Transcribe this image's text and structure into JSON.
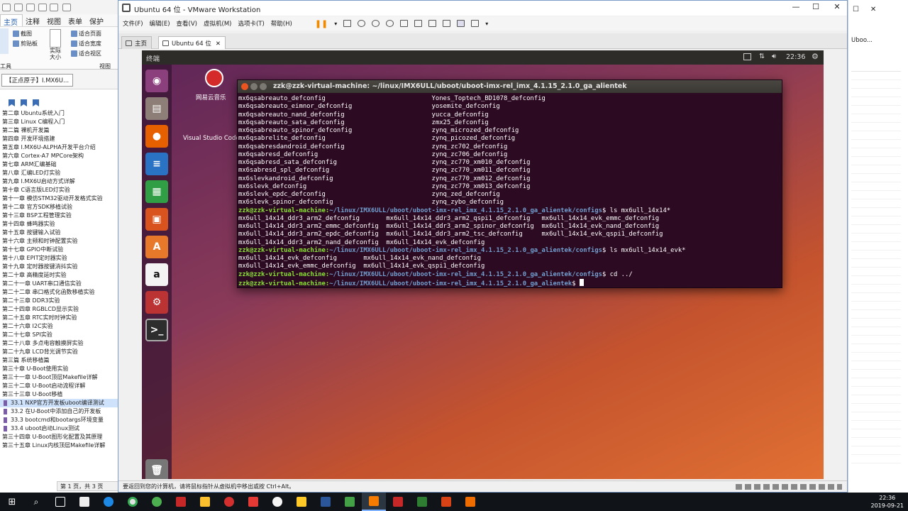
{
  "pdf_reader": {
    "tabs": [
      "主页",
      "注释",
      "视图",
      "表单",
      "保护"
    ],
    "ribbon": {
      "screenshot": "截图",
      "clipboard": "剪贴板",
      "actual_size": "实际大小",
      "fit_page": "适合页面",
      "fit_width": "适合宽度",
      "fit_view": "适合视区",
      "tools_group": "工具",
      "view_group": "视图"
    },
    "doc_tab": "【正点原子】I.MX6U...",
    "toc": [
      {
        "label": "第二章 Ubuntu系统入门"
      },
      {
        "label": "第三章 Linux C编程入门"
      },
      {
        "label": "第二篇 裸机开发篇"
      },
      {
        "label": "第四章 开发环境搭建"
      },
      {
        "label": "第五章 I.MX6U-ALPHA开发平台介绍"
      },
      {
        "label": "第六章 Cortex-A7 MPCore架构"
      },
      {
        "label": "第七章 ARM汇编基础"
      },
      {
        "label": "第八章 汇编LED灯实验"
      },
      {
        "label": "第九章 I.MX6U启动方式详解"
      },
      {
        "label": "第十章 C语言版LED灯实验"
      },
      {
        "label": "第十一章 模仿STM32驱动开发格式实验"
      },
      {
        "label": "第十二章 官方SDK移植试验"
      },
      {
        "label": "第十三章 BSP工程管理实验"
      },
      {
        "label": "第十四章 蜂鸣器实验"
      },
      {
        "label": "第十五章 按键输入试验"
      },
      {
        "label": "第十六章 主频和时钟配置实验"
      },
      {
        "label": "第十七章 GPIO中断试验"
      },
      {
        "label": "第十八章 EPIT定时器实验"
      },
      {
        "label": "第十九章 定时器按键消抖实验"
      },
      {
        "label": "第二十章 高精度延时实验"
      },
      {
        "label": "第二十一章 UART串口通信实验"
      },
      {
        "label": "第二十二章 串口格式化函数移植实验"
      },
      {
        "label": "第二十三章 DDR3实验"
      },
      {
        "label": "第二十四章 RGBLCD显示实验"
      },
      {
        "label": "第二十五章 RTC实时时钟实验"
      },
      {
        "label": "第二十六章 I2C实验"
      },
      {
        "label": "第二十七章 SPI实验"
      },
      {
        "label": "第二十八章 多点电容触摸屏实验"
      },
      {
        "label": "第二十九章 LCD背光调节实验"
      },
      {
        "label": "第三篇 系统移植篇"
      },
      {
        "label": "第三十章 U-Boot使用实验"
      },
      {
        "label": "第三十一章 U-Boot顶层Makefile详解"
      },
      {
        "label": "第三十二章 U-Boot启动流程详解"
      },
      {
        "label": "第三十三章 U-Boot移植"
      },
      {
        "label": "33.1 NXP官方开发板uboot编译测试",
        "sub": true,
        "selected": true
      },
      {
        "label": "33.2 在U-Boot中添加自己的开发板",
        "sub": true
      },
      {
        "label": "33.3 bootcmd和bootargs环境变量",
        "sub": true
      },
      {
        "label": "33.4 uboot启动Linux测试",
        "sub": true
      },
      {
        "label": "第三十四章 U-Boot图形化配置及其原理"
      },
      {
        "label": "第三十五章 Linux内核顶层Makefile详解"
      }
    ],
    "status": "第 1 页，共 3 页"
  },
  "vmware": {
    "title": "Ubuntu 64 位 - VMware Workstation",
    "menu": [
      "文件(F)",
      "编辑(E)",
      "查看(V)",
      "虚拟机(M)",
      "选项卡(T)",
      "帮助(H)"
    ],
    "tabs": {
      "home": "主页",
      "vm": "Ubuntu 64 位"
    },
    "status_msg": "要返回到您的计算机，请将鼠标指针从虚拟机中移出或按 Ctrl+Alt。",
    "guest": {
      "topbar_title": "终端",
      "clock": "22:36",
      "desktop_icon_label": "网易云音乐",
      "desktop_icon2_label": "Visual Studio Code",
      "launcher": [
        "ubuntu-dash",
        "files",
        "firefox",
        "libreoffice-writer",
        "libreoffice-calc",
        "libreoffice-impress",
        "ubuntu-software",
        "amazon",
        "system-settings",
        "terminal",
        "trash"
      ],
      "terminal": {
        "title": "zzk@zzk-virtual-machine: ~/linux/IMX6ULL/uboot/uboot-imx-rel_imx_4.1.15_2.1.0_ga_alientek",
        "lines": [
          {
            "text": "mx6qsabreauto_defconfig                            Yones_Toptech_BD1078_defconfig"
          },
          {
            "text": "mx6qsabreauto_eimnor_defconfig                     yosemite_defconfig"
          },
          {
            "text": "mx6qsabreauto_nand_defconfig                       yucca_defconfig"
          },
          {
            "text": "mx6qsabreauto_sata_defconfig                       zmx25_defconfig"
          },
          {
            "text": "mx6qsabreauto_spinor_defconfig                     zynq_microzed_defconfig"
          },
          {
            "text": "mx6qsabrelite_defconfig                            zynq_picozed_defconfig"
          },
          {
            "text": "mx6qsabresdandroid_defconfig                       zynq_zc702_defconfig"
          },
          {
            "text": "mx6qsabresd_defconfig                              zynq_zc706_defconfig"
          },
          {
            "text": "mx6qsabresd_sata_defconfig                         zynq_zc770_xm010_defconfig"
          },
          {
            "text": "mx6sabresd_spl_defconfig                           zynq_zc770_xm011_defconfig"
          },
          {
            "text": "mx6slevkandroid_defconfig                          zynq_zc770_xm012_defconfig"
          },
          {
            "text": "mx6slevk_defconfig                                 zynq_zc770_xm013_defconfig"
          },
          {
            "text": "mx6slevk_epdc_defconfig                            zynq_zed_defconfig"
          },
          {
            "text": "mx6slevk_spinor_defconfig                          zynq_zybo_defconfig"
          },
          {
            "user": "zzk@zzk-virtual-machine",
            "path": "~/linux/IMX6ULL/uboot/uboot-imx-rel_imx_4.1.15_2.1.0_ga_alientek/configs",
            "cmd": "$ ls mx6ull_14x14*"
          },
          {
            "text": "mx6ull_14x14_ddr3_arm2_defconfig       mx6ull_14x14_ddr3_arm2_qspi1_defconfig   mx6ull_14x14_evk_emmc_defconfig"
          },
          {
            "text": "mx6ull_14x14_ddr3_arm2_emmc_defconfig  mx6ull_14x14_ddr3_arm2_spinor_defconfig  mx6ull_14x14_evk_nand_defconfig"
          },
          {
            "text": "mx6ull_14x14_ddr3_arm2_epdc_defconfig  mx6ull_14x14_ddr3_arm2_tsc_defconfig     mx6ull_14x14_evk_qspi1_defconfig"
          },
          {
            "text": "mx6ull_14x14_ddr3_arm2_nand_defconfig  mx6ull_14x14_evk_defconfig"
          },
          {
            "user": "zzk@zzk-virtual-machine",
            "path": "~/linux/IMX6ULL/uboot/uboot-imx-rel_imx_4.1.15_2.1.0_ga_alientek/configs",
            "cmd": "$ ls mx6ull_14x14_evk*"
          },
          {
            "text": "mx6ull_14x14_evk_defconfig       mx6ull_14x14_evk_nand_defconfig"
          },
          {
            "text": "mx6ull_14x14_evk_emmc_defconfig  mx6ull_14x14_evk_qspi1_defconfig"
          },
          {
            "user": "zzk@zzk-virtual-machine",
            "path": "~/linux/IMX6ULL/uboot/uboot-imx-rel_imx_4.1.15_2.1.0_ga_alientek/configs",
            "cmd": "$ cd ../"
          },
          {
            "user": "zzk@zzk-virtual-machine",
            "path": "~/linux/IMX6ULL/uboot/uboot-imx-rel_imx_4.1.15_2.1.0_ga_alientek",
            "cmd": "$ ",
            "cursor": true
          }
        ]
      }
    }
  },
  "right_panel": {
    "text": "Uboo..."
  },
  "taskbar": {
    "time": "22:36",
    "date": "2019-09-21",
    "apps": [
      "start",
      "search",
      "task-view",
      "vmware",
      "edge",
      "chrome",
      "360",
      "fake",
      "netease",
      "wps",
      "word",
      "vmware-taskbar",
      "filezilla",
      "camtasia",
      "app",
      "app2"
    ]
  },
  "colors": {
    "terminal_bg": "#2c0a22",
    "prompt": "#8ae234",
    "path": "#729fcf"
  }
}
